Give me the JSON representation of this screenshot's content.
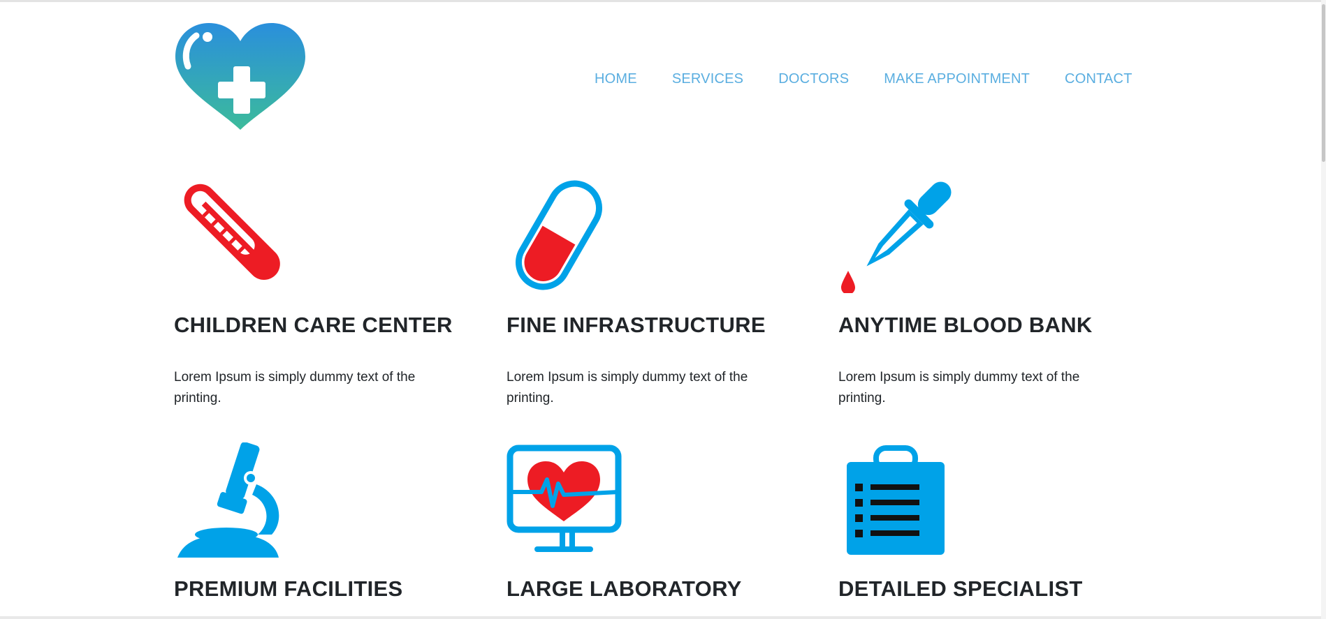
{
  "nav": {
    "items": [
      {
        "label": "HOME"
      },
      {
        "label": "SERVICES"
      },
      {
        "label": "DOCTORS"
      },
      {
        "label": "MAKE APPOINTMENT"
      },
      {
        "label": "CONTACT"
      }
    ]
  },
  "colors": {
    "nav_link": "#5aaee0",
    "icon_red": "#ed1c24",
    "icon_blue": "#00a2e8",
    "logo_top": "#2a8fdc",
    "logo_bottom": "#3cbb9b"
  },
  "features": [
    {
      "icon": "thermometer-icon",
      "title": "CHILDREN CARE CENTER",
      "text": "Lorem Ipsum is simply dummy text of the printing."
    },
    {
      "icon": "pill-capsule-icon",
      "title": "FINE INFRASTRUCTURE",
      "text": "Lorem Ipsum is simply dummy text of the printing."
    },
    {
      "icon": "dropper-icon",
      "title": "ANYTIME BLOOD BANK",
      "text": "Lorem Ipsum is simply dummy text of the printing."
    },
    {
      "icon": "microscope-icon",
      "title": "PREMIUM FACILITIES",
      "text": ""
    },
    {
      "icon": "heart-monitor-icon",
      "title": "LARGE LABORATORY",
      "text": ""
    },
    {
      "icon": "clipboard-icon",
      "title": "DETAILED SPECIALIST",
      "text": ""
    }
  ]
}
